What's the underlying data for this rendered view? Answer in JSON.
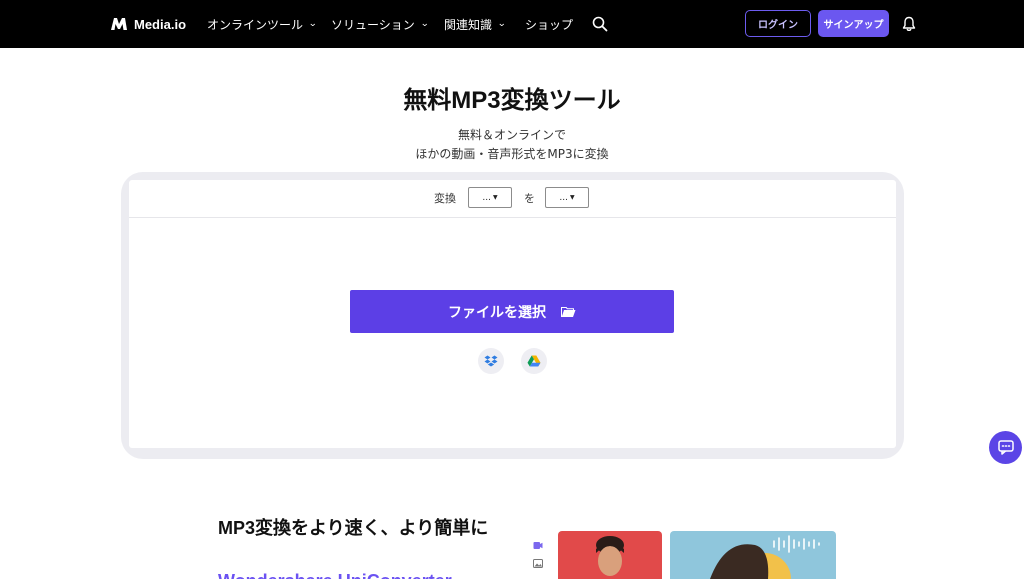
{
  "brand": {
    "name": "Media.io"
  },
  "nav": {
    "menu": [
      {
        "label": "オンラインツール",
        "has_dropdown": true
      },
      {
        "label": "ソリューション",
        "has_dropdown": true
      },
      {
        "label": "関連知識",
        "has_dropdown": true
      },
      {
        "label": "ショップ",
        "has_dropdown": false
      }
    ],
    "login_label": "ログイン",
    "signup_label": "サインアップ",
    "icons": {
      "search": "search-icon",
      "notifications": "bell-icon"
    }
  },
  "hero": {
    "title": "無料MP3変換ツール",
    "subtitle_line1": "無料＆オンラインで",
    "subtitle_line2": "ほかの動画・音声形式をMP3に変換"
  },
  "converter": {
    "convert_label": "変換",
    "to_label": "を",
    "from_value": "...",
    "to_value": "...",
    "choose_file_label": "ファイルを選択",
    "cloud_sources": [
      "dropbox-icon",
      "google-drive-icon"
    ]
  },
  "feature": {
    "title": "MP3変換をより速く、より簡単に",
    "subtitle": "Wondershare UniConverter"
  },
  "colors": {
    "nav_bg": "#000000",
    "accent": "#5c3fe6",
    "signup_bg": "#6b57f0",
    "card_shadow": "#ececf1",
    "thumb_red": "#e14a4a",
    "thumb_blue": "#8fc6dc"
  }
}
